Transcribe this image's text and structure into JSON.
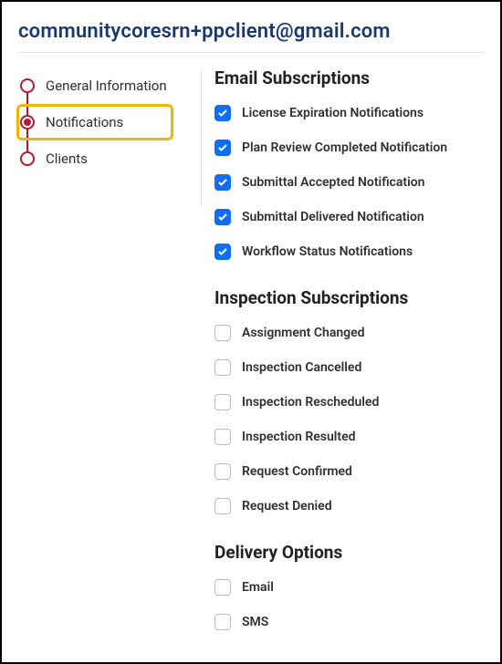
{
  "page_title": "communitycoresrn+ppclient@gmail.com",
  "sidebar": {
    "items": [
      {
        "label": "General Information",
        "active": false
      },
      {
        "label": "Notifications",
        "active": true
      },
      {
        "label": "Clients",
        "active": false
      }
    ]
  },
  "sections": {
    "email": {
      "title": "Email Subscriptions",
      "items": [
        {
          "label": "License Expiration Notifications",
          "checked": true
        },
        {
          "label": "Plan Review Completed Notification",
          "checked": true
        },
        {
          "label": "Submittal Accepted Notification",
          "checked": true
        },
        {
          "label": "Submittal Delivered Notification",
          "checked": true
        },
        {
          "label": "Workflow Status Notifications",
          "checked": true
        }
      ]
    },
    "inspection": {
      "title": "Inspection Subscriptions",
      "items": [
        {
          "label": "Assignment Changed",
          "checked": false
        },
        {
          "label": "Inspection Cancelled",
          "checked": false
        },
        {
          "label": "Inspection Rescheduled",
          "checked": false
        },
        {
          "label": "Inspection Resulted",
          "checked": false
        },
        {
          "label": "Request Confirmed",
          "checked": false
        },
        {
          "label": "Request Denied",
          "checked": false
        }
      ]
    },
    "delivery": {
      "title": "Delivery Options",
      "items": [
        {
          "label": "Email",
          "checked": false
        },
        {
          "label": "SMS",
          "checked": false
        }
      ]
    }
  }
}
